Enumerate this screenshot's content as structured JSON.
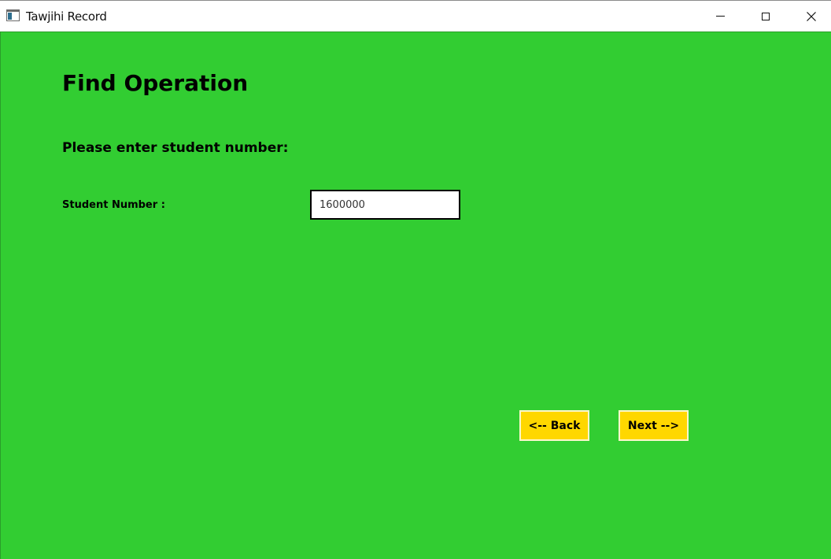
{
  "window": {
    "title": "Tawjihi Record",
    "app_icon": "window-app-icon",
    "controls": {
      "minimize": "minimize-icon",
      "maximize": "maximize-icon",
      "close": "close-icon"
    }
  },
  "form": {
    "background_color": "#32cd32",
    "title": "Find Operation",
    "prompt": "Please enter student number:",
    "student_number_label": "Student Number :",
    "student_number_value": "1600000"
  },
  "buttons": {
    "color": "#ffd700",
    "back_label": "<-- Back",
    "next_label": "Next -->"
  }
}
